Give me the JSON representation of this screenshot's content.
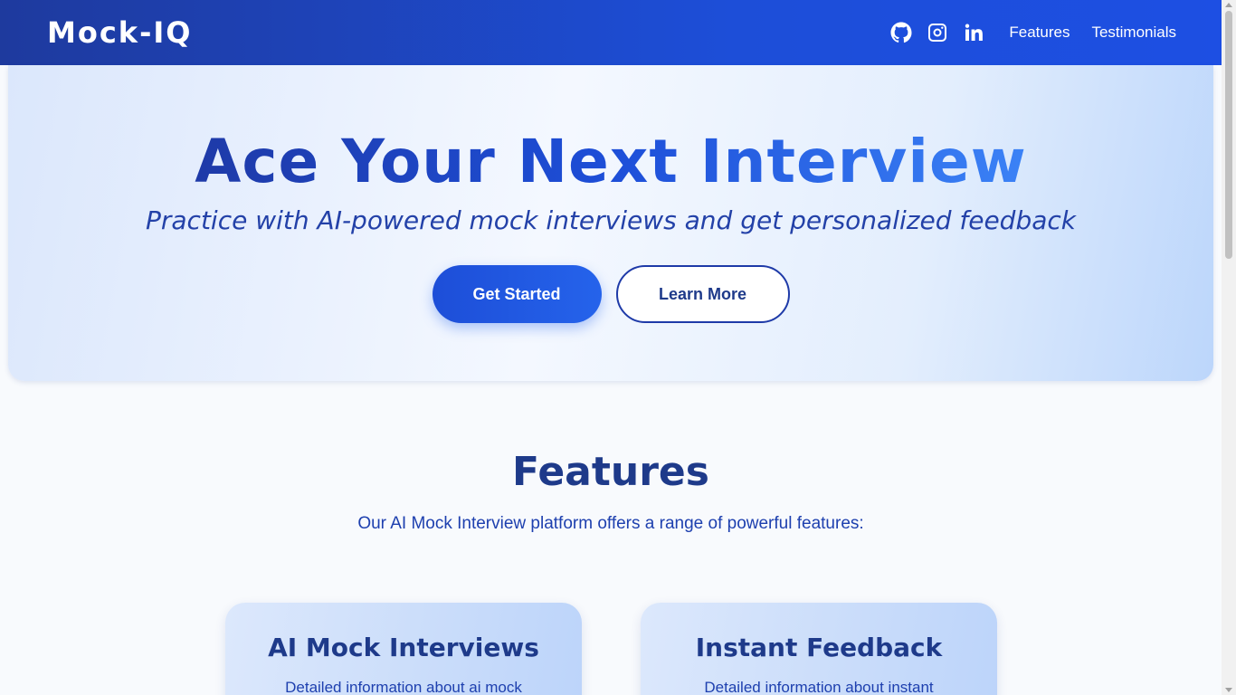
{
  "header": {
    "logo": "Mock-IQ",
    "icons": [
      "github-icon",
      "instagram-icon",
      "linkedin-icon"
    ],
    "nav_links": [
      "Features",
      "Testimonials"
    ]
  },
  "hero": {
    "title": "Ace Your Next Interview",
    "subtitle": "Practice with AI-powered mock interviews and get personalized feedback",
    "primary_button": "Get Started",
    "secondary_button": "Learn More"
  },
  "features": {
    "title": "Features",
    "subtitle": "Our AI Mock Interview platform offers a range of powerful features:",
    "cards": [
      {
        "title": "AI Mock Interviews",
        "description": "Detailed information about ai mock interviews"
      },
      {
        "title": "Instant Feedback",
        "description": "Detailed information about instant feedback"
      }
    ]
  },
  "colors": {
    "header_bg": "#1d4ed8",
    "primary": "#2563eb",
    "heading": "#1e3a8a"
  }
}
